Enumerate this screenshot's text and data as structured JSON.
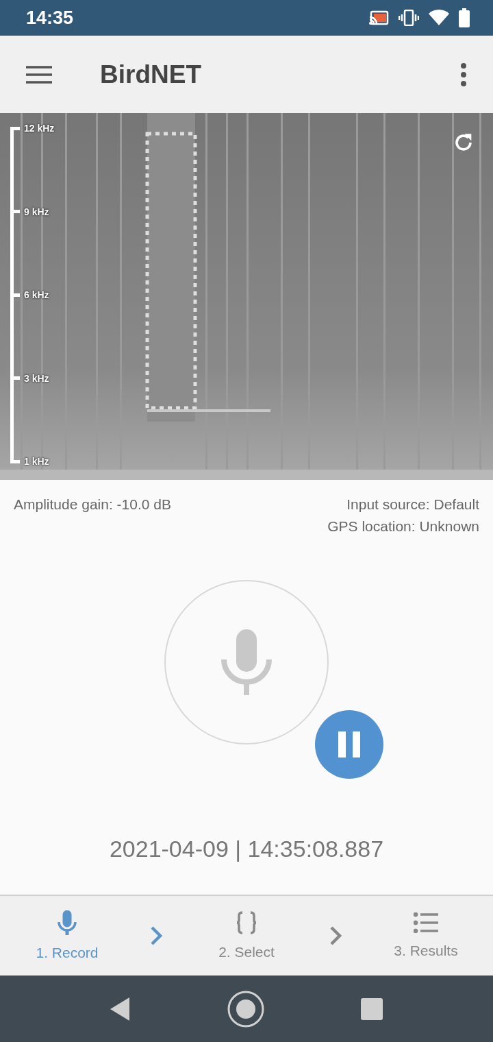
{
  "status_bar": {
    "time": "14:35"
  },
  "app_bar": {
    "title": "BirdNET"
  },
  "spectrogram": {
    "kind": "picture",
    "axis_labels": [
      "12 kHz",
      "9 kHz",
      "6 kHz",
      "3 kHz",
      "1 kHz"
    ]
  },
  "info": {
    "amplitude_gain": "Amplitude gain: -10.0 dB",
    "input_source": "Input source: Default",
    "gps_location": "GPS location: Unknown"
  },
  "recording": {
    "paused": false,
    "timestamp": "2021-04-09 | 14:35:08.887"
  },
  "steps": [
    {
      "label": "1. Record",
      "kind": "mic",
      "selected": true
    },
    {
      "label": "2. Select",
      "kind": "braces",
      "selected": false
    },
    {
      "label": "3. Results",
      "kind": "list",
      "selected": false
    }
  ]
}
